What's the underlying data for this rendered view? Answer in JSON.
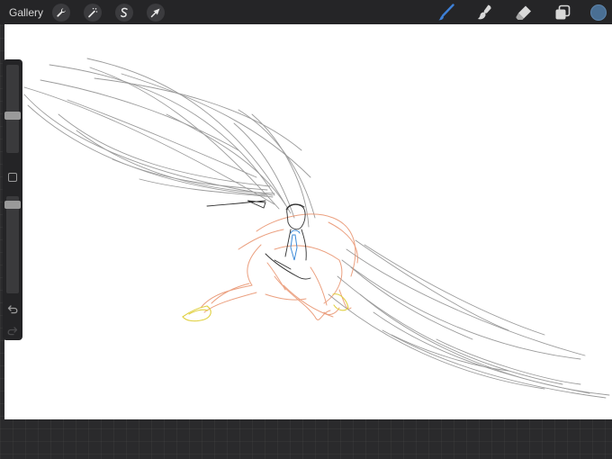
{
  "topbar": {
    "gallery_label": "Gallery",
    "left_tools": [
      "wrench-icon",
      "magic-wand-icon",
      "selection-icon",
      "transform-arrow-icon"
    ],
    "right_tools": [
      "brush-icon",
      "smudge-icon",
      "eraser-icon",
      "layers-icon"
    ],
    "active_tool": "brush-icon",
    "accent_color": "#3d7fd6",
    "current_color": "#4a6f94"
  },
  "sidebar": {
    "brush_size_level": 0.42,
    "opacity_level": 0.95
  },
  "canvas": {
    "background": "#ffffff",
    "stroke_colors": [
      "#6b6b6b",
      "#e8906a",
      "#e0d040",
      "#3e8bd8"
    ]
  }
}
